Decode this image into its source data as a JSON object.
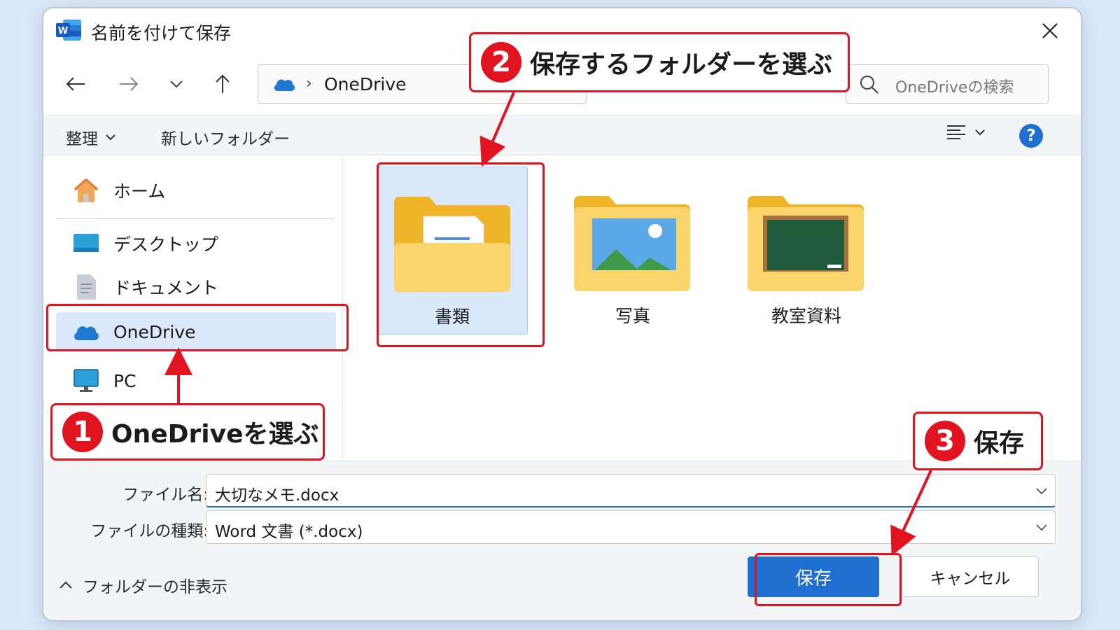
{
  "dialog": {
    "title": "名前を付けて保存",
    "app_icon": "word-icon",
    "app_icon_letter": "W"
  },
  "nav": {
    "address": {
      "location": "OneDrive"
    },
    "search": {
      "placeholder": "OneDriveの検索"
    }
  },
  "toolbar": {
    "organize_label": "整理",
    "new_folder_label": "新しいフォルダー"
  },
  "sidebar": {
    "items": [
      {
        "label": "ホーム",
        "icon": "home-icon"
      },
      {
        "label": "デスクトップ",
        "icon": "desktop-icon"
      },
      {
        "label": "ドキュメント",
        "icon": "documents-icon"
      },
      {
        "label": "OneDrive",
        "icon": "onedrive-cloud-icon",
        "selected": true
      },
      {
        "label": "PC",
        "icon": "pc-monitor-icon"
      }
    ]
  },
  "folders": [
    {
      "name": "書類",
      "icon": "documents-folder-icon",
      "selected": true
    },
    {
      "name": "写真",
      "icon": "pictures-folder-icon"
    },
    {
      "name": "教室資料",
      "icon": "classroom-folder-icon"
    }
  ],
  "footer": {
    "filename_label": "ファイル名:",
    "filename_value": "大切なメモ.docx",
    "filetype_label": "ファイルの種類:",
    "filetype_value": "Word 文書 (*.docx)",
    "hide_folders_label": "フォルダーの非表示",
    "save_label": "保存",
    "cancel_label": "キャンセル"
  },
  "annotations": {
    "step1": {
      "number": "1",
      "text": "OneDriveを選ぶ"
    },
    "step2": {
      "number": "2",
      "text": "保存するフォルダーを選ぶ"
    },
    "step3": {
      "number": "3",
      "text": "保存"
    }
  },
  "colors": {
    "accent": "#1f6fd1",
    "annotation_red": "#e0131f",
    "selection": "#d9e8fb",
    "folder_yellow": "#f7c948"
  }
}
